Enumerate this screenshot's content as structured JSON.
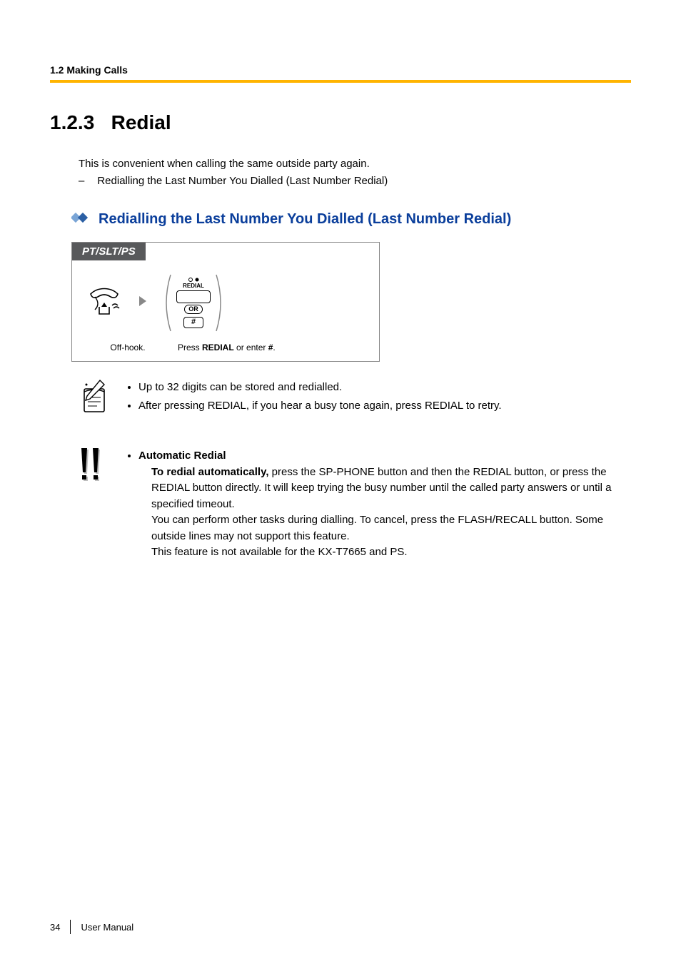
{
  "header": {
    "running": "1.2 Making Calls"
  },
  "section": {
    "number": "1.2.3",
    "title": "Redial"
  },
  "intro": {
    "line1": "This is convenient when calling the same outside party again.",
    "dash": "–",
    "line2": "Redialling the Last Number You Dialled (Last Number Redial)"
  },
  "subheading": "Redialling the Last Number You Dialled (Last Number Redial)",
  "diagram": {
    "tab": "PT/SLT/PS",
    "redial_small": "REDIAL",
    "or": "OR",
    "hash": "#",
    "caption1": "Off-hook.",
    "caption2_pre": "Press ",
    "caption2_bold": "REDIAL",
    "caption2_mid": " or enter ",
    "caption2_hash": "#",
    "caption2_end": "."
  },
  "notes": {
    "n1": "Up to 32 digits can be stored and redialled.",
    "n2": "After pressing REDIAL, if you hear a busy tone again, press REDIAL to retry."
  },
  "auto": {
    "title": "Automatic Redial",
    "p1_bold": "To redial automatically,",
    "p1_rest": " press the SP-PHONE button and then the REDIAL button, or press the REDIAL button directly. It will keep trying the busy number until the called party answers or until a specified timeout.",
    "p2": "You can perform other tasks during dialling. To cancel, press the FLASH/RECALL button. Some outside lines may not support this feature.",
    "p3": "This feature is not available for the KX-T7665 and PS."
  },
  "footer": {
    "page": "34",
    "label": "User Manual"
  }
}
